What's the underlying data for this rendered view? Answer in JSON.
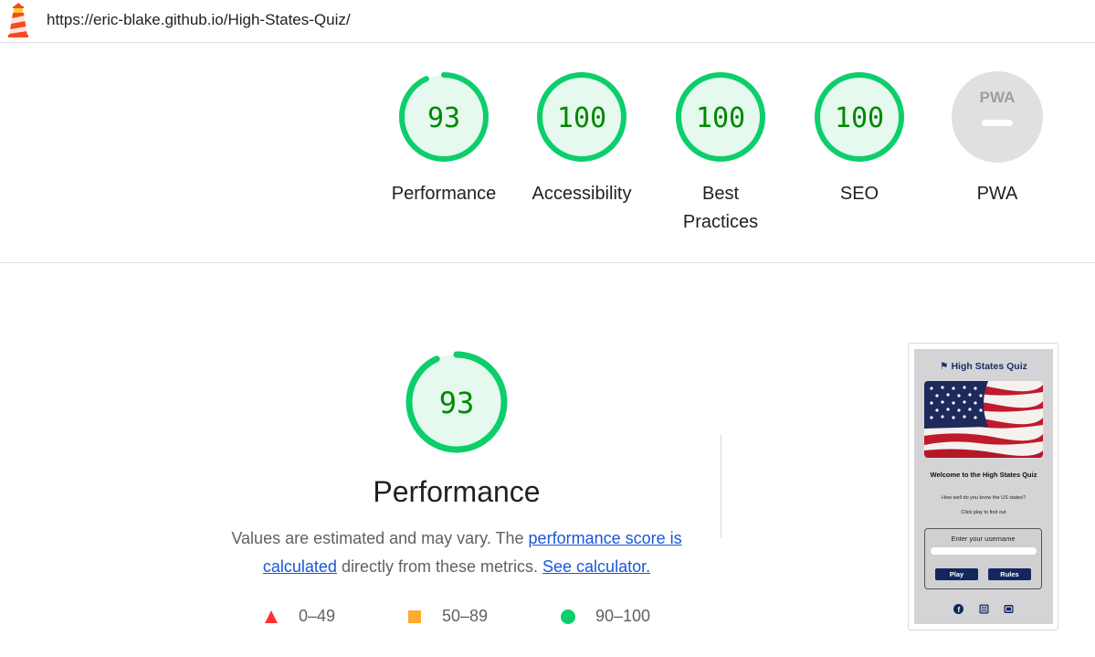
{
  "header": {
    "url": "https://eric-blake.github.io/High-States-Quiz/",
    "logo_icon": "lighthouse-icon"
  },
  "summary": {
    "gauges": [
      {
        "label": "Performance",
        "score": "93",
        "value": 93
      },
      {
        "label": "Accessibility",
        "score": "100",
        "value": 100
      },
      {
        "label": "Best Practices",
        "score": "100",
        "value": 100
      },
      {
        "label": "SEO",
        "score": "100",
        "value": 100
      },
      {
        "label": "PWA",
        "badge_text": "PWA",
        "icon": "pwa-dash-icon"
      }
    ]
  },
  "performance": {
    "score": "93",
    "value": 93,
    "title": "Performance",
    "desc_before": "Values are estimated and may vary. The ",
    "desc_link1": "performance score is calculated",
    "desc_middle": " directly from these metrics. ",
    "desc_link2": "See calculator."
  },
  "legend": [
    {
      "range": "0–49",
      "icon": "red-triangle-icon",
      "color": "#f33"
    },
    {
      "range": "50–89",
      "icon": "orange-square-icon",
      "color": "#ffaa33"
    },
    {
      "range": "90–100",
      "icon": "green-circle-icon",
      "color": "#0cce6b"
    }
  ],
  "colors": {
    "pass": "#0cce6b",
    "pass_fill": "#e5f9ee",
    "pass_text": "#008800",
    "pwa_gray": "#e0e0e0"
  },
  "thumbnail": {
    "title": "High States Quiz",
    "title_icon": "flag-icon",
    "welcome": "Welcome to the High States Quiz",
    "subtitle": "How well do you know the US states?",
    "hint": "Click play to find out",
    "username_label": "Enter your username",
    "play_label": "Play",
    "rules_label": "Rules",
    "social_icons": [
      "facebook-icon",
      "instagram-icon",
      "youtube-icon"
    ]
  }
}
